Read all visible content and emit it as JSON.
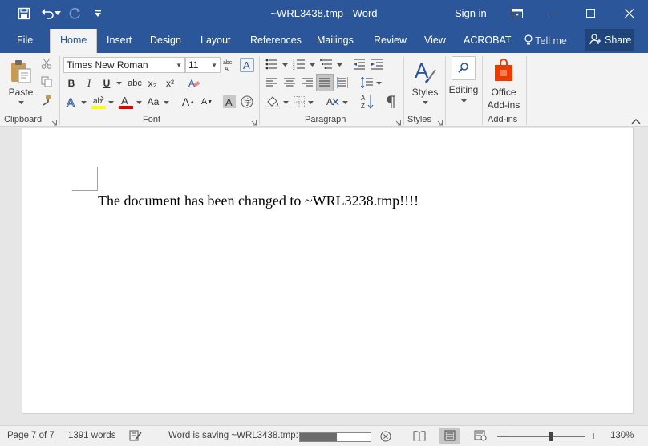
{
  "titlebar": {
    "title": "~WRL3438.tmp  -  Word",
    "signin": "Sign in"
  },
  "tabs": [
    {
      "label": "File"
    },
    {
      "label": "Home"
    },
    {
      "label": "Insert"
    },
    {
      "label": "Design"
    },
    {
      "label": "Layout"
    },
    {
      "label": "References"
    },
    {
      "label": "Mailings"
    },
    {
      "label": "Review"
    },
    {
      "label": "View"
    },
    {
      "label": "ACROBAT"
    },
    {
      "label": "Tell me"
    }
  ],
  "share": "Share",
  "ribbon": {
    "clipboard": {
      "paste": "Paste",
      "group": "Clipboard"
    },
    "font": {
      "name": "Times New Roman",
      "size": "11",
      "group": "Font",
      "bold": "B",
      "italic": "I",
      "underline": "U",
      "strike": "abc",
      "sub": "x₂",
      "sup": "x²",
      "grow": "A",
      "shrink": "A",
      "case": "Aa",
      "color_letter": "A",
      "clear": "A"
    },
    "paragraph": {
      "group": "Paragraph"
    },
    "styles": {
      "label": "Styles",
      "group": "Styles"
    },
    "editing": {
      "label": "Editing"
    },
    "addins": {
      "label1": "Office",
      "label2": "Add-ins",
      "group": "Add-ins"
    }
  },
  "document": {
    "text": "The document has been changed to ~WRL3238.tmp!!!!"
  },
  "status": {
    "page": "Page 7 of 7",
    "words": "1391 words",
    "saving": "Word is saving ~WRL3438.tmp:",
    "progress": 0.52,
    "zoom": "130%"
  },
  "colors": {
    "brand": "#2b579a",
    "highlight": "#ffff00",
    "fontcolor": "#e00000",
    "addins": "#eb3c00"
  }
}
